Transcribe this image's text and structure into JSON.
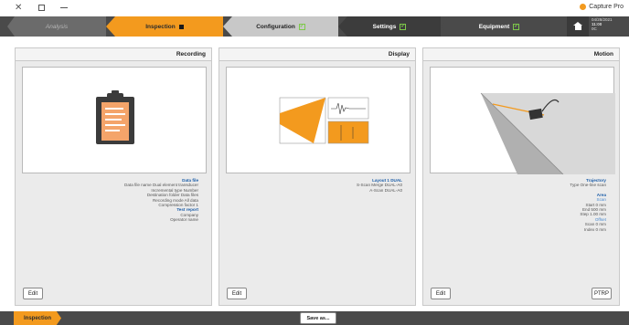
{
  "app": {
    "title": "Capture Pro"
  },
  "steps": {
    "analysis": "Analysis",
    "inspection": "Inspection",
    "configuration": "Configuration",
    "settings": "Settings",
    "equipment": "Equipment"
  },
  "clock": {
    "date": "04/28/2021",
    "time": "11:00",
    "indicator": "0C"
  },
  "recording": {
    "title": "Recording",
    "data_file_header": "Data file",
    "data_file_rows": [
      "Data file name     Dual element transducer",
      "Incremental type          Number",
      "Destination folder       Data files",
      "Recording mode             All data",
      "Compression factor              1"
    ],
    "test_report_header": "Test report",
    "test_report_rows": [
      "Company",
      "Operator name"
    ],
    "edit_label": "Edit"
  },
  "display": {
    "title": "Display",
    "layout_header": "Layout 1 DUAL",
    "layout_rows": [
      "S-Scan Merge     DUAL-A0",
      "A-Scan              DUAL-A0"
    ],
    "edit_label": "Edit"
  },
  "motion": {
    "title": "Motion",
    "trajectory_header": "Trajectory",
    "trajectory_row": "Type     One-line scan",
    "area_header": "Area",
    "scan_sub": "Scan",
    "scan_rows": [
      "Start       0 mm",
      "End      500 mm",
      "Step       1.00 mm"
    ],
    "offset_sub": "Offset",
    "offset_rows": [
      "Scan        0 mm",
      "Index       0 mm"
    ],
    "edit_label": "Edit",
    "ptrp_label": "PTRP"
  },
  "bottom": {
    "inspection_label": "Inspection",
    "save_label": "Save as..."
  },
  "colors": {
    "accent": "#f39a1e",
    "dark_bar": "#4a4a4a",
    "link_blue": "#1d5ea8"
  }
}
